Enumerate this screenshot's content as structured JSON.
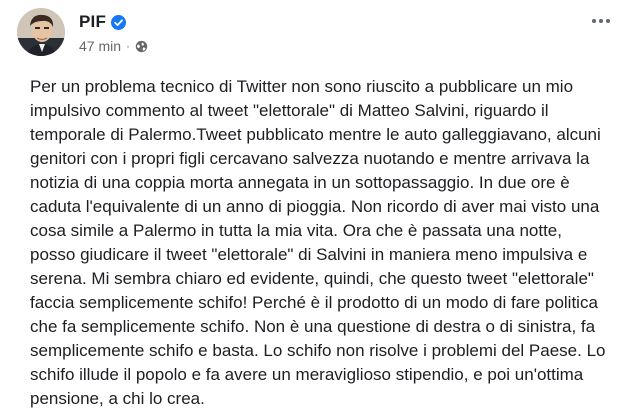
{
  "author": {
    "name": "PIF",
    "verified_icon": "verified-check-icon",
    "avatar": "profile-photo"
  },
  "meta": {
    "time": "47 min",
    "separator": "·",
    "audience_icon": "globe-icon"
  },
  "menu": {
    "icon": "more-options-icon"
  },
  "post": {
    "lines": [
      "Per un problema tecnico di Twitter non sono riuscito a pubblicare un mio",
      "impulsivo commento al tweet \"elettorale\" di Matteo Salvini, riguardo il",
      "temporale di Palermo.Tweet pubblicato mentre le auto galleggiavano, alcuni",
      "genitori con i propri figli cercavano salvezza nuotando e mentre arrivava la",
      "notizia di una coppia morta annegata in un sottopassaggio. In due ore è",
      "caduta l'equivalente di un anno di pioggia. Non ricordo di aver mai visto una",
      "cosa simile a Palermo in tutta la mia vita. Ora che è passata una notte,",
      "posso giudicare il tweet \"elettorale\" di Salvini in maniera meno impulsiva e",
      "serena. Mi sembra chiaro ed evidente, quindi, che questo tweet \"elettorale\"",
      "faccia semplicemente schifo! Perché è il prodotto di un modo di fare politica",
      "che fa semplicemente schifo. Non è una questione di destra o di sinistra, fa",
      "semplicemente schifo e basta. Lo schifo non risolve i problemi del Paese. Lo",
      "schifo illude il popolo e fa avere un meraviglioso stipendio, e poi un'ottima",
      "pensione, a chi lo crea."
    ]
  },
  "colors": {
    "text": "#1c1e21",
    "secondary": "#65676b",
    "verified": "#1877f2"
  }
}
